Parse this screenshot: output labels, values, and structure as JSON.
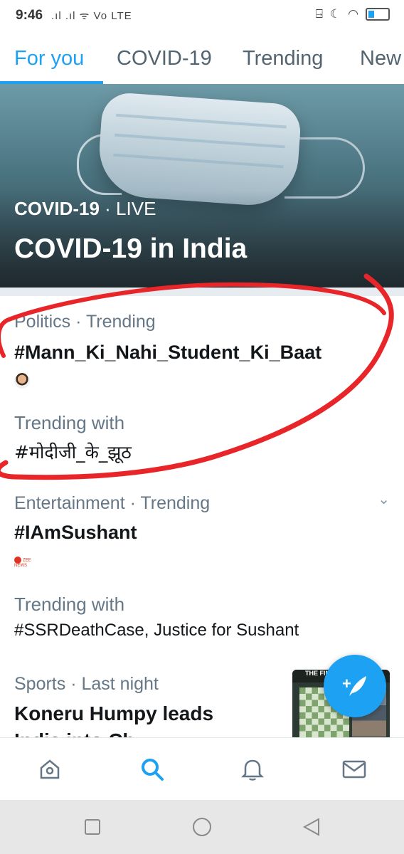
{
  "status_bar": {
    "time": "9:46",
    "network": "Vo LTE"
  },
  "tabs": [
    {
      "label": "For you",
      "active": true
    },
    {
      "label": "COVID-19",
      "active": false
    },
    {
      "label": "Trending",
      "active": false
    },
    {
      "label": "New",
      "active": false
    }
  ],
  "hero": {
    "category": "COVID-19",
    "status": "LIVE",
    "title": "COVID-19 in India"
  },
  "trends": [
    {
      "meta": "Politics · Trending",
      "headline": "#Mann_Ki_Nahi_Student_Ki_Baat",
      "trending_with_label": "Trending with",
      "trending_with": "#मोदीजी_के_झूठ"
    },
    {
      "meta": "Entertainment · Trending",
      "headline": "#IAmSushant",
      "source_logo": "ZEE NEWS",
      "trending_with_label": "Trending with",
      "trending_with": "#SSRDeathCase, Justice for Sushant"
    },
    {
      "meta": "Sports · Last night",
      "headline": "Koneru Humpy leads",
      "headline_cut": "India into Ch",
      "thumb_header": "THE FIN"
    }
  ],
  "fab": {
    "plus": "+",
    "icon": "feather-icon"
  },
  "bottom_nav": [
    {
      "icon": "home-icon",
      "active": false
    },
    {
      "icon": "search-icon",
      "active": true
    },
    {
      "icon": "bell-icon",
      "active": false
    },
    {
      "icon": "mail-icon",
      "active": false
    }
  ],
  "system_nav": [
    "square-icon",
    "circle-icon",
    "back-triangle-icon"
  ],
  "colors": {
    "accent": "#1da1f2",
    "annotation": "#e8262a",
    "muted": "#657786"
  }
}
